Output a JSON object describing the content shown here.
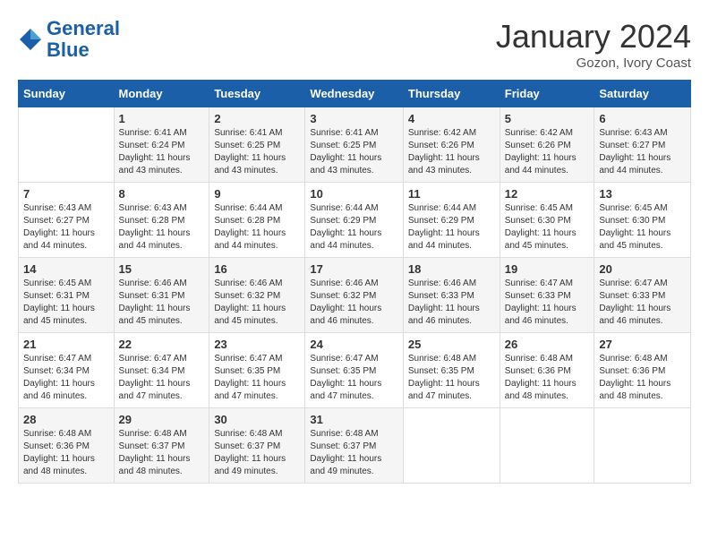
{
  "header": {
    "logo_line1": "General",
    "logo_line2": "Blue",
    "month_title": "January 2024",
    "location": "Gozon, Ivory Coast"
  },
  "weekdays": [
    "Sunday",
    "Monday",
    "Tuesday",
    "Wednesday",
    "Thursday",
    "Friday",
    "Saturday"
  ],
  "weeks": [
    [
      {
        "day": "",
        "sunrise": "",
        "sunset": "",
        "daylight": ""
      },
      {
        "day": "1",
        "sunrise": "Sunrise: 6:41 AM",
        "sunset": "Sunset: 6:24 PM",
        "daylight": "Daylight: 11 hours and 43 minutes."
      },
      {
        "day": "2",
        "sunrise": "Sunrise: 6:41 AM",
        "sunset": "Sunset: 6:25 PM",
        "daylight": "Daylight: 11 hours and 43 minutes."
      },
      {
        "day": "3",
        "sunrise": "Sunrise: 6:41 AM",
        "sunset": "Sunset: 6:25 PM",
        "daylight": "Daylight: 11 hours and 43 minutes."
      },
      {
        "day": "4",
        "sunrise": "Sunrise: 6:42 AM",
        "sunset": "Sunset: 6:26 PM",
        "daylight": "Daylight: 11 hours and 43 minutes."
      },
      {
        "day": "5",
        "sunrise": "Sunrise: 6:42 AM",
        "sunset": "Sunset: 6:26 PM",
        "daylight": "Daylight: 11 hours and 44 minutes."
      },
      {
        "day": "6",
        "sunrise": "Sunrise: 6:43 AM",
        "sunset": "Sunset: 6:27 PM",
        "daylight": "Daylight: 11 hours and 44 minutes."
      }
    ],
    [
      {
        "day": "7",
        "sunrise": "Sunrise: 6:43 AM",
        "sunset": "Sunset: 6:27 PM",
        "daylight": "Daylight: 11 hours and 44 minutes."
      },
      {
        "day": "8",
        "sunrise": "Sunrise: 6:43 AM",
        "sunset": "Sunset: 6:28 PM",
        "daylight": "Daylight: 11 hours and 44 minutes."
      },
      {
        "day": "9",
        "sunrise": "Sunrise: 6:44 AM",
        "sunset": "Sunset: 6:28 PM",
        "daylight": "Daylight: 11 hours and 44 minutes."
      },
      {
        "day": "10",
        "sunrise": "Sunrise: 6:44 AM",
        "sunset": "Sunset: 6:29 PM",
        "daylight": "Daylight: 11 hours and 44 minutes."
      },
      {
        "day": "11",
        "sunrise": "Sunrise: 6:44 AM",
        "sunset": "Sunset: 6:29 PM",
        "daylight": "Daylight: 11 hours and 44 minutes."
      },
      {
        "day": "12",
        "sunrise": "Sunrise: 6:45 AM",
        "sunset": "Sunset: 6:30 PM",
        "daylight": "Daylight: 11 hours and 45 minutes."
      },
      {
        "day": "13",
        "sunrise": "Sunrise: 6:45 AM",
        "sunset": "Sunset: 6:30 PM",
        "daylight": "Daylight: 11 hours and 45 minutes."
      }
    ],
    [
      {
        "day": "14",
        "sunrise": "Sunrise: 6:45 AM",
        "sunset": "Sunset: 6:31 PM",
        "daylight": "Daylight: 11 hours and 45 minutes."
      },
      {
        "day": "15",
        "sunrise": "Sunrise: 6:46 AM",
        "sunset": "Sunset: 6:31 PM",
        "daylight": "Daylight: 11 hours and 45 minutes."
      },
      {
        "day": "16",
        "sunrise": "Sunrise: 6:46 AM",
        "sunset": "Sunset: 6:32 PM",
        "daylight": "Daylight: 11 hours and 45 minutes."
      },
      {
        "day": "17",
        "sunrise": "Sunrise: 6:46 AM",
        "sunset": "Sunset: 6:32 PM",
        "daylight": "Daylight: 11 hours and 46 minutes."
      },
      {
        "day": "18",
        "sunrise": "Sunrise: 6:46 AM",
        "sunset": "Sunset: 6:33 PM",
        "daylight": "Daylight: 11 hours and 46 minutes."
      },
      {
        "day": "19",
        "sunrise": "Sunrise: 6:47 AM",
        "sunset": "Sunset: 6:33 PM",
        "daylight": "Daylight: 11 hours and 46 minutes."
      },
      {
        "day": "20",
        "sunrise": "Sunrise: 6:47 AM",
        "sunset": "Sunset: 6:33 PM",
        "daylight": "Daylight: 11 hours and 46 minutes."
      }
    ],
    [
      {
        "day": "21",
        "sunrise": "Sunrise: 6:47 AM",
        "sunset": "Sunset: 6:34 PM",
        "daylight": "Daylight: 11 hours and 46 minutes."
      },
      {
        "day": "22",
        "sunrise": "Sunrise: 6:47 AM",
        "sunset": "Sunset: 6:34 PM",
        "daylight": "Daylight: 11 hours and 47 minutes."
      },
      {
        "day": "23",
        "sunrise": "Sunrise: 6:47 AM",
        "sunset": "Sunset: 6:35 PM",
        "daylight": "Daylight: 11 hours and 47 minutes."
      },
      {
        "day": "24",
        "sunrise": "Sunrise: 6:47 AM",
        "sunset": "Sunset: 6:35 PM",
        "daylight": "Daylight: 11 hours and 47 minutes."
      },
      {
        "day": "25",
        "sunrise": "Sunrise: 6:48 AM",
        "sunset": "Sunset: 6:35 PM",
        "daylight": "Daylight: 11 hours and 47 minutes."
      },
      {
        "day": "26",
        "sunrise": "Sunrise: 6:48 AM",
        "sunset": "Sunset: 6:36 PM",
        "daylight": "Daylight: 11 hours and 48 minutes."
      },
      {
        "day": "27",
        "sunrise": "Sunrise: 6:48 AM",
        "sunset": "Sunset: 6:36 PM",
        "daylight": "Daylight: 11 hours and 48 minutes."
      }
    ],
    [
      {
        "day": "28",
        "sunrise": "Sunrise: 6:48 AM",
        "sunset": "Sunset: 6:36 PM",
        "daylight": "Daylight: 11 hours and 48 minutes."
      },
      {
        "day": "29",
        "sunrise": "Sunrise: 6:48 AM",
        "sunset": "Sunset: 6:37 PM",
        "daylight": "Daylight: 11 hours and 48 minutes."
      },
      {
        "day": "30",
        "sunrise": "Sunrise: 6:48 AM",
        "sunset": "Sunset: 6:37 PM",
        "daylight": "Daylight: 11 hours and 49 minutes."
      },
      {
        "day": "31",
        "sunrise": "Sunrise: 6:48 AM",
        "sunset": "Sunset: 6:37 PM",
        "daylight": "Daylight: 11 hours and 49 minutes."
      },
      {
        "day": "",
        "sunrise": "",
        "sunset": "",
        "daylight": ""
      },
      {
        "day": "",
        "sunrise": "",
        "sunset": "",
        "daylight": ""
      },
      {
        "day": "",
        "sunrise": "",
        "sunset": "",
        "daylight": ""
      }
    ]
  ]
}
